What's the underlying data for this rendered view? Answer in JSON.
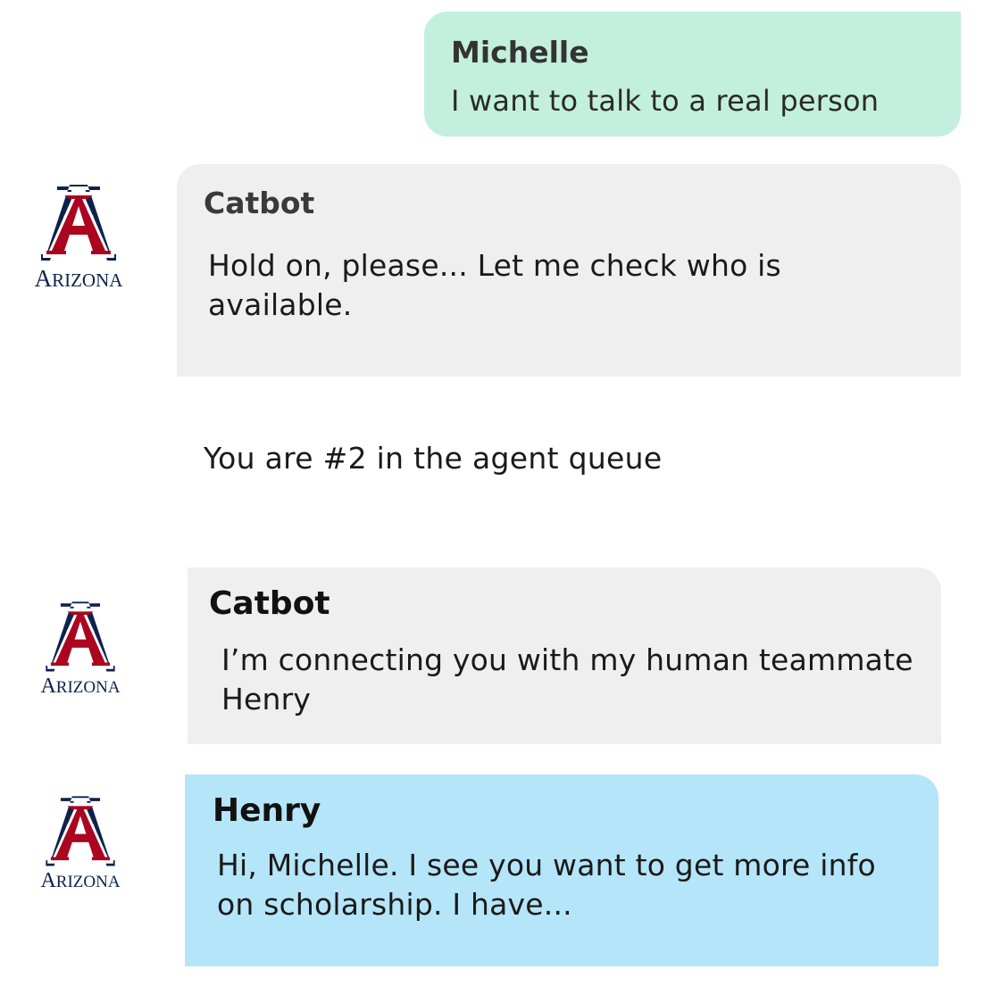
{
  "messages": [
    {
      "sender": "Michelle",
      "text": "I want to talk to a real person",
      "color": "#c3efdf"
    },
    {
      "sender": "Catbot",
      "text": "Hold on, please... Let me check who is available.",
      "color": "#efefef"
    },
    {
      "sender": "Catbot",
      "text": "I’m connecting you with my human teammate Henry",
      "color": "#efefef"
    },
    {
      "sender": "Henry",
      "text": "Hi, Michelle. I see you want to get more info on scholarship. I have...",
      "color": "#b5e5f8"
    }
  ],
  "queue_notice": "You are #2 in the agent queue",
  "logo": {
    "letter": "A",
    "wordmark_initial": "A",
    "wordmark_rest": "RIZONA",
    "icon": "arizona-block-a-logo",
    "colors": {
      "navy": "#0c234b",
      "red": "#ab0520"
    }
  }
}
